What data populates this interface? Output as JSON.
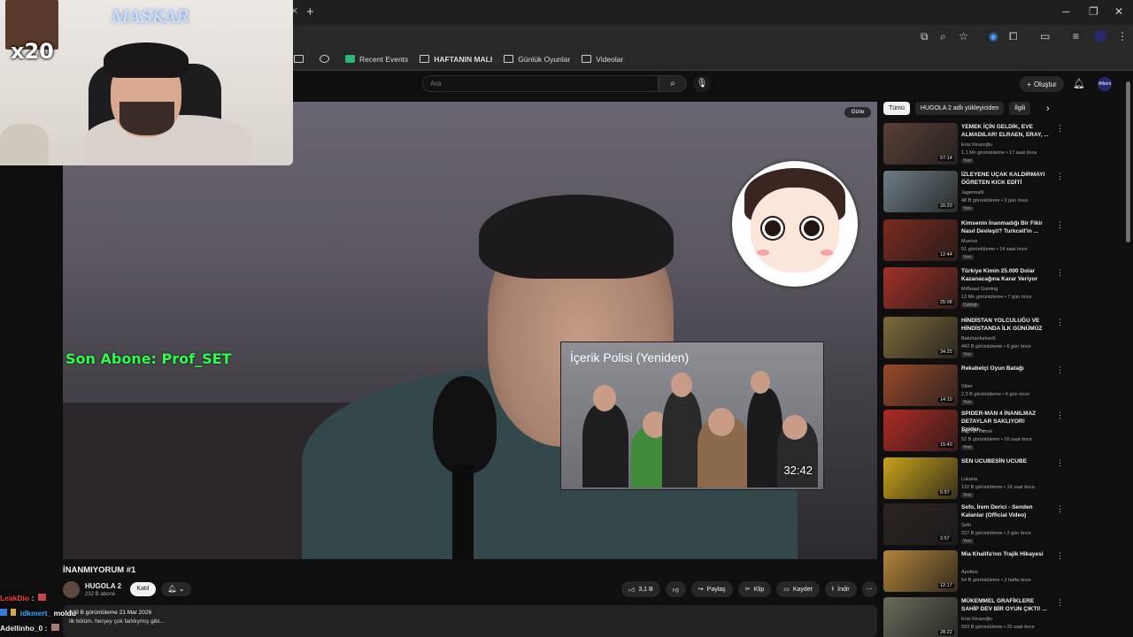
{
  "browser": {
    "bookmarks": [
      {
        "label": "Recent Events",
        "icon": "green-app-icon"
      },
      {
        "label": "HAFTANIN MALI",
        "icon": "folder-icon"
      },
      {
        "label": "Günlük Oyunlar",
        "icon": "folder-icon"
      },
      {
        "label": "Videolar",
        "icon": "folder-icon"
      }
    ]
  },
  "header": {
    "search_placeholder": "Ara",
    "create_label": "Oluştur",
    "avatar_label": "Afbeni"
  },
  "player": {
    "hide_label": "Gizle",
    "overlay_subscriber": "Son Abone: Prof_SET",
    "card": {
      "title": "İçerik Polisi (Yeniden)",
      "duration": "32:42"
    }
  },
  "video": {
    "title": "İNANMIYORUM #1",
    "channel": "HUGOLA 2",
    "subscribers": "232 B abone",
    "join_label": "Katıl",
    "likes": "3,1 B",
    "share_label": "Paylaş",
    "clip_label": "Klip",
    "save_label": "Kaydet",
    "download_label": "İndir",
    "desc_views_date": "229 B görüntüleme  21 Mar 2026",
    "desc_text": "ilk bölüm. herşey çok farklıymış gibi..."
  },
  "chips": [
    "Tümü",
    "HUGOLA 2 adlı yükleyiciden",
    "İlgili"
  ],
  "recommendations": [
    {
      "title": "YEMEK İÇİN GELDİK, EVE ALMADILAR! ELRAEN, ERAY, ...",
      "channel": "Enis Kirazoğlu",
      "meta": "1,1 Mn görüntüleme • 17 saat önce",
      "badge": "Yeni",
      "duration": "57:14",
      "color": "#5a4038"
    },
    {
      "title": "İZLEYENE UÇAK KALDIRMAYI ÖĞRETEN KICK EDİTİ",
      "channel": "JagermaN",
      "meta": "48 B görüntüleme • 3 gün önce",
      "badge": "Yeni",
      "duration": "20:20",
      "color": "#6e7d84"
    },
    {
      "title": "Kimsenin İnanmadığı Bir Fikir Nasıl Devleşti? Turkcell'in ...",
      "channel": "Muerus",
      "meta": "51 görüntüleme • 14 saat önce",
      "badge": "Yeni",
      "duration": "12:44",
      "color": "#7a2a1f"
    },
    {
      "title": "Türkiye Kimin 25.000 Dolar Kazanacağına Karar Veriyor",
      "channel": "MrBeast Gaming",
      "meta": "13 Mn görüntüleme • 7 gün önce",
      "badge": "Dublajlı",
      "duration": "25:08",
      "color": "#a33028"
    },
    {
      "title": "HİNDİSTAN YOLCULUĞU VE HİNDİSTANDA İLK GÜNÜMÜZ",
      "channel": "Batuhanfurkan5",
      "meta": "442 B görüntüleme • 6 gün önce",
      "badge": "Yeni",
      "duration": "34:25",
      "color": "#7d6a3a"
    },
    {
      "title": "Rekabetçi Oyun Batağı",
      "channel": "Siber",
      "meta": "2,3 B görüntüleme • 6 gün önce",
      "badge": "Yeni",
      "duration": "14:10",
      "color": "#9a4a2a"
    },
    {
      "title": "SPIDER-MAN 4 İNANILMAZ DETAYLAR SAKLIYOR! Spider-...",
      "channel": "Ergi'nin Kanalı",
      "meta": "52 B görüntüleme • 16 saat önce",
      "badge": "Yeni",
      "duration": "15:40",
      "color": "#b02a24"
    },
    {
      "title": "SEN UCUBESİN UCUBE",
      "channel": "Lukaria",
      "meta": "132 B görüntüleme • 19 saat önce",
      "badge": "Yeni",
      "duration": "5:57",
      "color": "#c7a21a"
    },
    {
      "title": "Sefo, İrem Derici - Senden Kalanlar (Official Video)",
      "channel": "Sefo",
      "meta": "227 B görüntüleme • 2 gün önce",
      "badge": "Yeni",
      "duration": "2:57",
      "color": "#2a2420"
    },
    {
      "title": "Mia Khalifa'nın Trajik Hikayesi",
      "channel": "Apofeni",
      "meta": "54 B görüntüleme • 2 hafta önce",
      "badge": "",
      "duration": "12:17",
      "color": "#b3843a"
    },
    {
      "title": "MÜKEMMEL GRAFİKLERE SAHİP DEV BİR OYUN ÇIKTI! ...",
      "channel": "Enis Kirazoğlu",
      "meta": "593 B görüntüleme • 20 saat önce",
      "badge": "",
      "duration": "28:22",
      "color": "#6a6a5a"
    }
  ],
  "webcam": {
    "multiplier": "x20",
    "brand": "MASKAR"
  },
  "chat": [
    {
      "user": "LeakDio",
      "suffix": " :",
      "color": "#ff3b3b"
    },
    {
      "user": "idkmert_",
      "suffix": "",
      "color": "#3aa8ff"
    },
    {
      "user": "Adellinho_0",
      "suffix": " :",
      "color": "#f1f1f1"
    }
  ],
  "chat_overlap_text": "moldu"
}
